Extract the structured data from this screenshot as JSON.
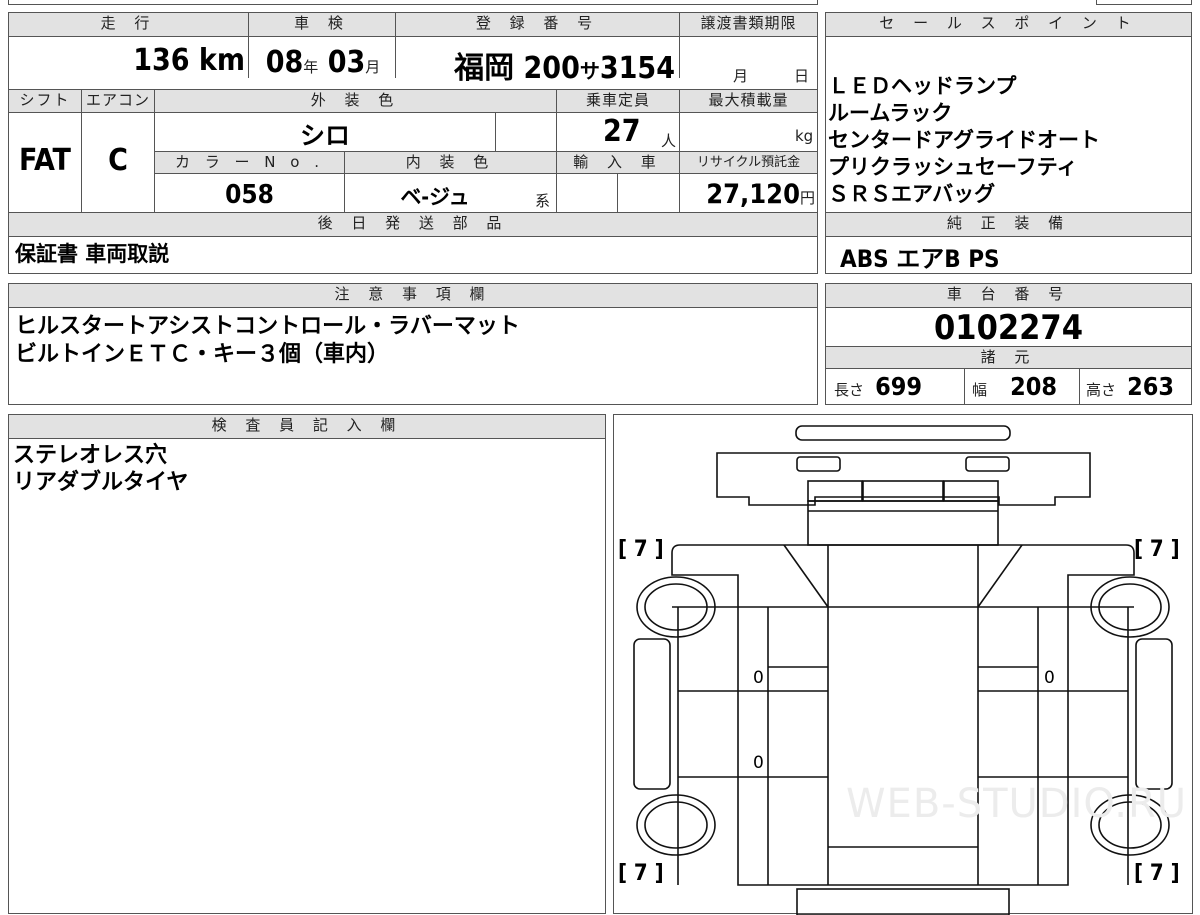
{
  "headers": {
    "mileage": "走 行",
    "inspection": "車 検",
    "registration": "登 録 番 号",
    "transfer_deadline": "譲渡書類期限",
    "sales_points": "セ ー ル ス ポ イ ン ト",
    "shift": "シフト",
    "aircon": "エアコン",
    "exterior_color": "外 装 色",
    "capacity": "乗車定員",
    "max_load": "最大積載量",
    "color_no": "カ ラ ー N o .",
    "interior_color": "内 装 色",
    "import_car": "輸 入 車",
    "recycle_fee": "リサイクル預託金",
    "later_parts": "後 日 発 送 部 品",
    "genuine_equipment": "純 正 装 備",
    "notes": "注 意 事 項 欄",
    "chassis_no": "車 台 番 号",
    "specs": "諸 元",
    "inspector": "検 査 員 記 入 欄"
  },
  "vehicle": {
    "mileage": "136",
    "mileage_unit": "km",
    "inspection_year": "08",
    "inspection_year_unit": "年",
    "inspection_month": "03",
    "inspection_month_unit": "月",
    "plate_region": "福岡",
    "plate_class": "200",
    "plate_kana": "サ",
    "plate_number": "3154",
    "deadline_month": "月",
    "deadline_day": "日",
    "shift": "FAT",
    "aircon": "C",
    "exterior_color": "シロ",
    "capacity": "27",
    "capacity_unit": "人",
    "max_load_unit": "kg",
    "color_no": "058",
    "interior_color": "ベ-ジュ",
    "interior_suffix": "系",
    "recycle_fee": "27,120",
    "recycle_unit": "円"
  },
  "sales_points": [
    "ＬＥＤヘッドランプ",
    "ルームラック",
    "センタードアグライドオート",
    "プリクラッシュセーフティ",
    "ＳＲＳエアバッグ"
  ],
  "later_parts": "保証書 車両取説",
  "genuine_equipment": "ABS エアB PS",
  "notes": [
    "ヒルスタートアシストコントロール・ラバーマット",
    "ビルトインＥＴＣ・キー３個（車内）"
  ],
  "chassis_no": "0102274",
  "specs": {
    "length_label": "長さ",
    "length": "699",
    "width_label": "幅",
    "width": "208",
    "height_label": "高さ",
    "height": "263"
  },
  "inspector": [
    "ステレオレス穴",
    "リアダブルタイヤ"
  ],
  "diagram": {
    "tire_fl": "[ 7 ]",
    "tire_fr": "[ 7 ]",
    "tire_rl": "[ 7 ]",
    "tire_rr": "[ 7 ]",
    "mark_1": "0",
    "mark_2": "0",
    "mark_3": "0"
  },
  "watermark": "WEB-STUDIO.RU"
}
